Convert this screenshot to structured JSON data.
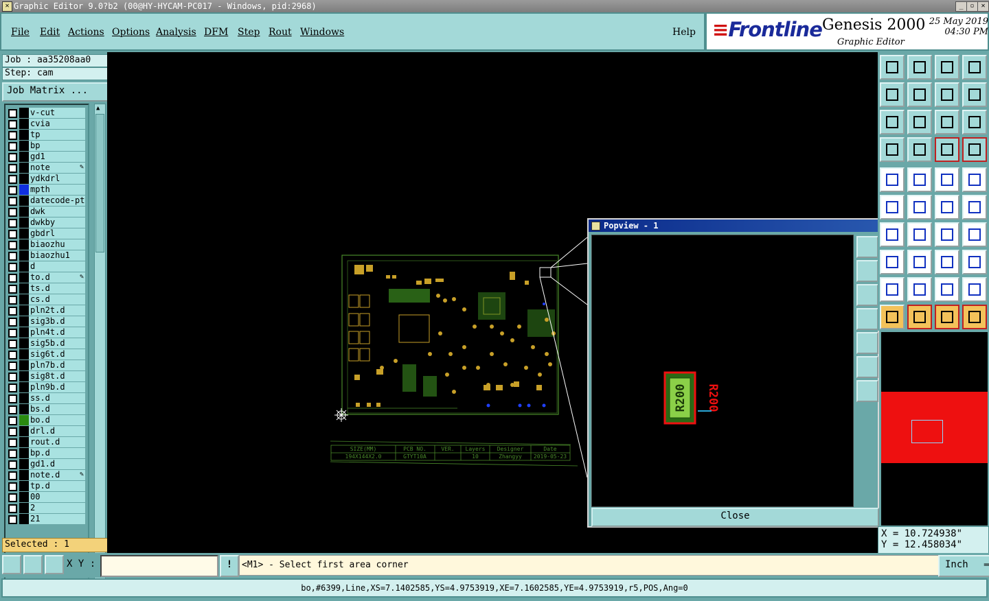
{
  "window": {
    "title": "Graphic Editor 9.0?b2 (00@HY-HYCAM-PC017 - Windows, pid:2968)"
  },
  "menu": {
    "items": [
      "File",
      "Edit",
      "Actions",
      "Options",
      "Analysis",
      "DFM",
      "Step",
      "Rout",
      "Windows"
    ],
    "help": "Help"
  },
  "brand": {
    "logo": "Frontline",
    "product": "Genesis 2000",
    "subtitle": "Graphic Editor",
    "date": "25 May 2019",
    "time": "04:30 PM"
  },
  "job": {
    "job_text": "Job : aa35208aa0",
    "step_text": "Step: cam",
    "job_matrix": "Job Matrix ..."
  },
  "layers": [
    {
      "name": "v-cut"
    },
    {
      "name": "cvia"
    },
    {
      "name": "tp"
    },
    {
      "name": "bp"
    },
    {
      "name": "gd1"
    },
    {
      "name": "note",
      "mark": "✎"
    },
    {
      "name": "ydkdrl"
    },
    {
      "name": "mpth",
      "color": "#1030e0"
    },
    {
      "name": "datecode-pt"
    },
    {
      "name": "dwk"
    },
    {
      "name": "dwkby"
    },
    {
      "name": "gbdrl"
    },
    {
      "name": "biaozhu"
    },
    {
      "name": "biaozhu1"
    },
    {
      "name": "d"
    },
    {
      "name": "to.d",
      "mark": "✎"
    },
    {
      "name": "ts.d"
    },
    {
      "name": "cs.d"
    },
    {
      "name": "pln2t.d"
    },
    {
      "name": "sig3b.d"
    },
    {
      "name": "pln4t.d"
    },
    {
      "name": "sig5b.d"
    },
    {
      "name": "sig6t.d"
    },
    {
      "name": "pln7b.d"
    },
    {
      "name": "sig8t.d"
    },
    {
      "name": "pln9b.d"
    },
    {
      "name": "ss.d"
    },
    {
      "name": "bs.d"
    },
    {
      "name": "bo.d",
      "color": "#2a8a10"
    },
    {
      "name": "drl.d"
    },
    {
      "name": "rout.d"
    },
    {
      "name": "bp.d"
    },
    {
      "name": "gd1.d"
    },
    {
      "name": "note.d",
      "mark": "✎"
    },
    {
      "name": "tp.d"
    },
    {
      "name": "00"
    },
    {
      "name": "2"
    },
    {
      "name": "21"
    }
  ],
  "selected": "Selected : 1",
  "title_block": {
    "headers": [
      "SIZE(MM)",
      "PCB NO.",
      "VER.",
      "Layers",
      "Designer",
      "Date"
    ],
    "values": [
      "194X144X2.0",
      "GTYT10A",
      "",
      "10",
      "Zhangyy",
      "2019-05-23"
    ]
  },
  "popview": {
    "title": "Popview - 1",
    "close_label": "Close",
    "component_text": "R200"
  },
  "coords": {
    "x_text": "X = 10.724938\"",
    "y_text": "Y = 12.458034\""
  },
  "command": {
    "xy_label": "X Y :",
    "xy_value": "",
    "prompt": "<M1> - Select first area corner",
    "units": "Inch",
    "excl": "!"
  },
  "status": "bo,#6399,Line,XS=7.1402585,YS=4.9753919,XE=7.1602585,YE=4.9753919,r5,POS,Ang=0",
  "colors": {
    "panel": "#6aa8a8",
    "button": "#a3d9d8",
    "field": "#d3f0ef",
    "selected_bg": "#f3d27a",
    "highlight_red": "#ee1010",
    "board_green": "#4a8a2a"
  }
}
